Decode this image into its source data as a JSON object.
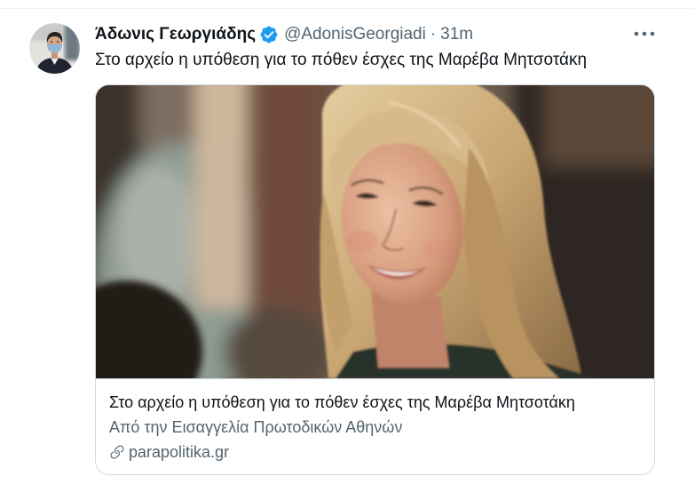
{
  "tweet": {
    "author_name": "Άδωνις Γεωργιάδης",
    "verified": true,
    "handle": "@AdonisGeorgiadi",
    "separator": "·",
    "time": "31m",
    "text": "Στο αρχείο η υπόθεση για το πόθεν έσχες της Μαρέβα Μητσοτάκη"
  },
  "card": {
    "title": "Στο αρχείο η υπόθεση για το πόθεν έσχες της Μαρέβα Μητσοτάκη",
    "description": "Από την Εισαγγελία Πρωτοδικών Αθηνών",
    "domain": "parapolitika.gr"
  },
  "icons": {
    "verified": "verified-badge-icon",
    "more": "more-icon",
    "link": "link-icon"
  },
  "colors": {
    "text_primary": "#0f1419",
    "text_secondary": "#536471",
    "verified_blue": "#1d9bf0",
    "border": "#cfd9de"
  }
}
